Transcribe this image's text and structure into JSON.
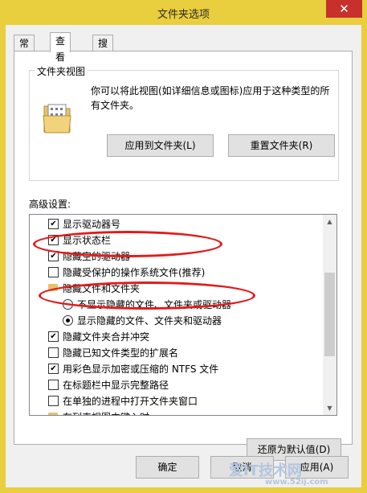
{
  "window": {
    "title": "文件夹选项",
    "close_glyph": "✕"
  },
  "tabs": [
    {
      "label": "常规"
    },
    {
      "label": "查看"
    },
    {
      "label": "搜索"
    }
  ],
  "folder_views": {
    "legend": "文件夹视图",
    "description": "你可以将此视图(如详细信息或图标)应用于这种类型的所有文件夹。",
    "apply_button": "应用到文件夹(L)",
    "reset_button": "重置文件夹(R)"
  },
  "advanced": {
    "label": "高级设置:",
    "items": [
      {
        "type": "checkbox",
        "checked": true,
        "label": "显示驱动器号"
      },
      {
        "type": "checkbox",
        "checked": true,
        "label": "显示状态栏"
      },
      {
        "type": "checkbox",
        "checked": true,
        "label": "隐藏空的驱动器"
      },
      {
        "type": "checkbox",
        "checked": false,
        "label": "隐藏受保护的操作系统文件(推荐)"
      },
      {
        "type": "folder",
        "label": "隐藏文件和文件夹"
      },
      {
        "type": "radio",
        "checked": false,
        "label": "不显示隐藏的文件、文件夹或驱动器"
      },
      {
        "type": "radio",
        "checked": true,
        "label": "显示隐藏的文件、文件夹和驱动器"
      },
      {
        "type": "checkbox",
        "checked": true,
        "label": "隐藏文件夹合并冲突"
      },
      {
        "type": "checkbox",
        "checked": false,
        "label": "隐藏已知文件类型的扩展名"
      },
      {
        "type": "checkbox",
        "checked": true,
        "label": "用彩色显示加密或压缩的 NTFS 文件"
      },
      {
        "type": "checkbox",
        "checked": false,
        "label": "在标题栏中显示完整路径"
      },
      {
        "type": "checkbox",
        "checked": false,
        "label": "在单独的进程中打开文件夹窗口"
      },
      {
        "type": "folder",
        "label": "在列表视图中键入时"
      }
    ],
    "restore_button": "还原为默认值(D)"
  },
  "footer": {
    "ok_button": "确定",
    "cancel_button": "取消",
    "apply_button": "应用(A)"
  },
  "watermark": {
    "text": "爱IT技术网",
    "url": "www.52ij.com"
  },
  "colors": {
    "highlight_oval": "#e21b1b",
    "close": "#c7302b",
    "frame": "#e9ce3e"
  },
  "icons": {
    "check": "✔",
    "up": "▲",
    "down": "▼"
  }
}
